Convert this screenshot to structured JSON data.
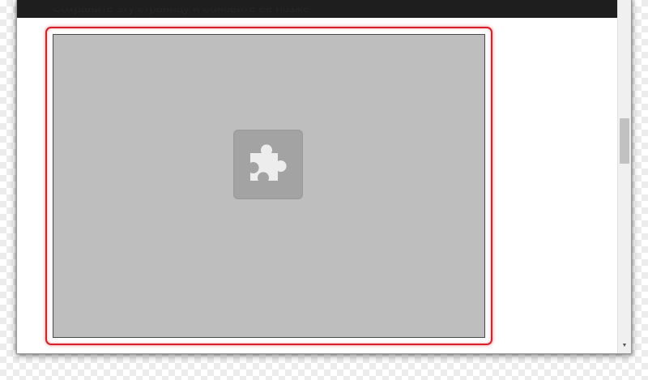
{
  "page": {
    "clipped_line": "Сохраните эту страницу и обновите её позже.",
    "plugin_placeholder_icon": "puzzle-piece-icon",
    "highlight_color": "#d8202a",
    "plugin_background": "#bebebe",
    "scroll_down_glyph": "▼"
  }
}
